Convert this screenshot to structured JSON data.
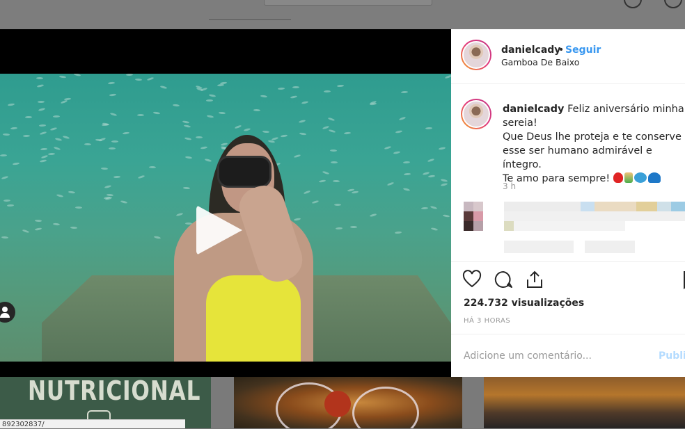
{
  "post": {
    "username": "danielcady",
    "separator": "•",
    "follow_label": "Seguir",
    "location": "Gamboa De Baixo",
    "caption_lines": [
      "Feliz aniversário minha",
      "sereia!",
      "Que Deus lhe proteja e te conserve",
      "esse ser humano admirável e íntegro.",
      "Te amo para sempre!"
    ],
    "caption_emojis": [
      "red-heart",
      "mermaid",
      "fish",
      "wave"
    ],
    "caption_time": "3 h",
    "views": "224.732 visualizações",
    "posted_ago": "HÁ 3 HORAS",
    "comment_placeholder": "Adicione um comentário...",
    "publish_label": "Publi"
  },
  "background": {
    "thumb_text": "NUTRICIONAL",
    "status_url": "892302837/"
  },
  "colors": {
    "link": "#3897f0",
    "publish_disabled": "#b3dbff",
    "secondary_text": "#999999",
    "text": "#262626"
  }
}
